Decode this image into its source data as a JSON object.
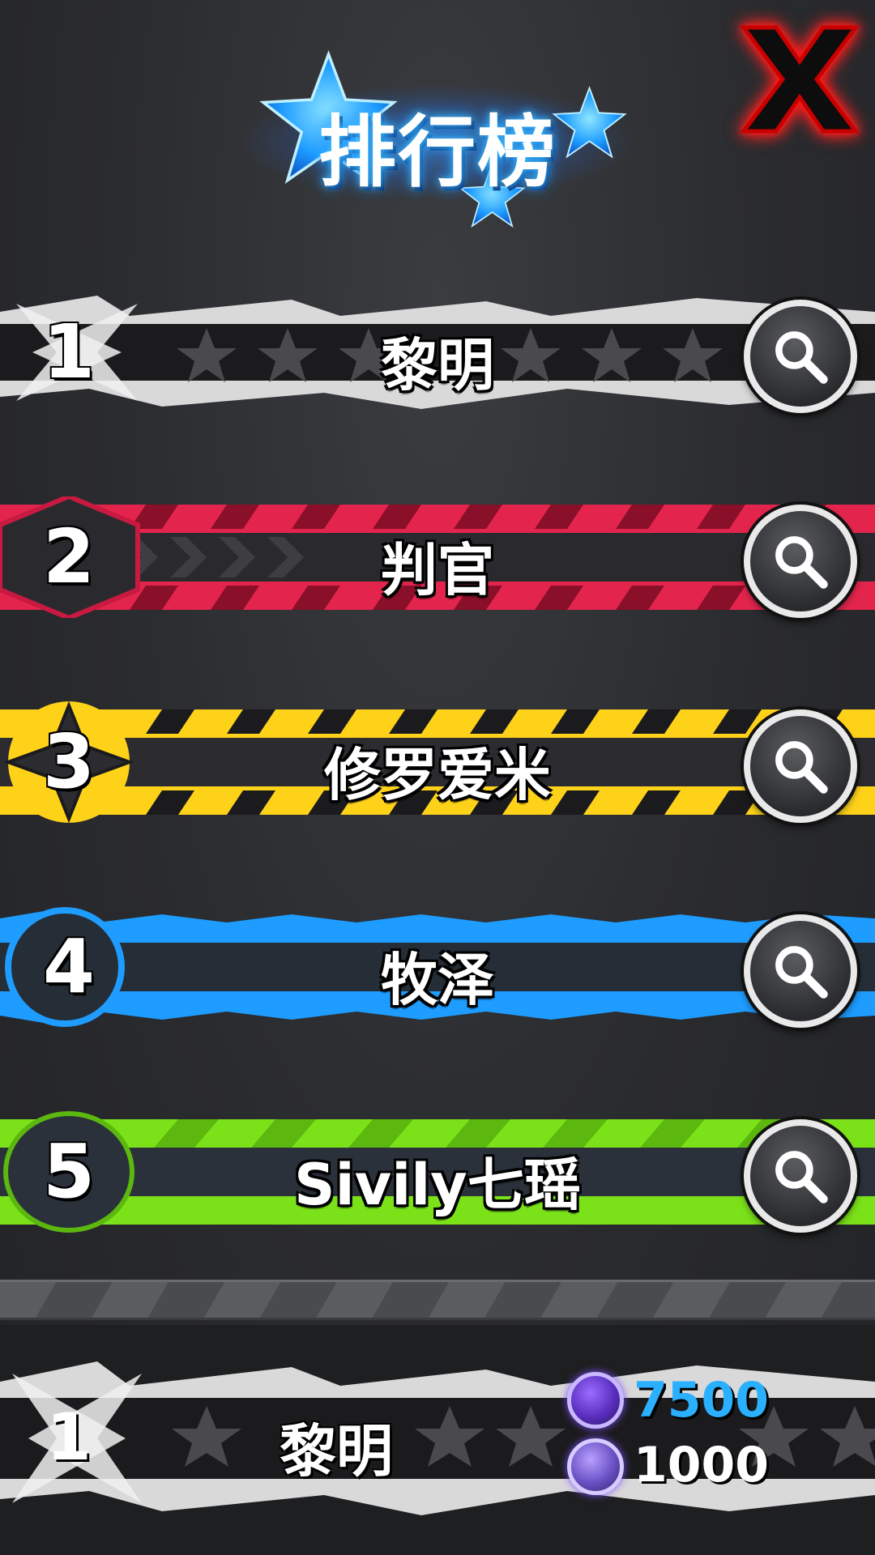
{
  "header": {
    "title": "排行榜",
    "close_label": "X"
  },
  "leaderboard": [
    {
      "rank": "1",
      "name": "黎明",
      "theme": "silver",
      "accent": "#e8e8e8"
    },
    {
      "rank": "2",
      "name": "判官",
      "theme": "red",
      "accent": "#e8204a"
    },
    {
      "rank": "3",
      "name": "修罗爱米",
      "theme": "yellow",
      "accent": "#ffd21a"
    },
    {
      "rank": "4",
      "name": "牧泽",
      "theme": "blue",
      "accent": "#1ea0ff"
    },
    {
      "rank": "5",
      "name": "Sivily七瑶",
      "theme": "green",
      "accent": "#7be21a"
    }
  ],
  "my_entry": {
    "rank": "1",
    "name": "黎明",
    "currency_primary": "7500",
    "currency_secondary": "1000"
  },
  "colors": {
    "title_glow": "#1e8cff",
    "close_red": "#ff1010",
    "primary_currency_text": "#2ab0ff",
    "secondary_currency_text": "#ffffff"
  },
  "icons": {
    "search": "search-icon",
    "close": "close-icon",
    "currency_primary": "gem-coin-icon",
    "currency_secondary": "crystal-coin-icon"
  }
}
